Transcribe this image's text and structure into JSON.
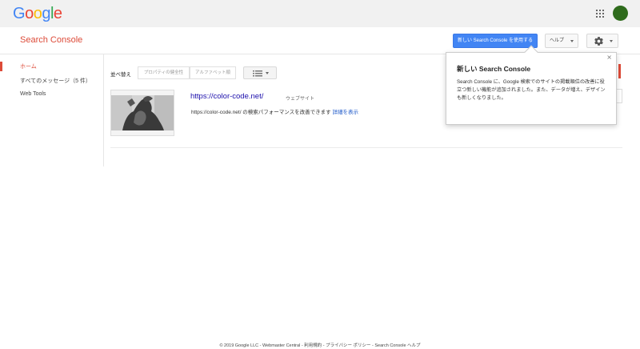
{
  "header": {
    "logo_letters": [
      {
        "char": "G",
        "color": "#4285f4"
      },
      {
        "char": "o",
        "color": "#ea4335"
      },
      {
        "char": "o",
        "color": "#fbbc05"
      },
      {
        "char": "g",
        "color": "#4285f4"
      },
      {
        "char": "l",
        "color": "#34a853"
      },
      {
        "char": "e",
        "color": "#ea4335"
      }
    ],
    "apps_icon": "apps-grid-icon",
    "avatar_color": "#2e6b1c"
  },
  "subheader": {
    "product_title": "Search Console",
    "new_search_console_button": "新しい Search Console を使用する",
    "help_button": "ヘルプ",
    "settings_icon": "gear-icon"
  },
  "sidebar": {
    "items": [
      {
        "label": "ホーム",
        "active": true
      },
      {
        "label": "すべてのメッセージ（5 件）",
        "active": false
      },
      {
        "label": "Web Tools",
        "active": false
      }
    ]
  },
  "toolbar": {
    "sort_label": "並べ替え",
    "sort_options": [
      "プロパティの健全性",
      "アルファベット順"
    ],
    "view_icon": "list-view-icon"
  },
  "sites": [
    {
      "url": "https://color-code.net/",
      "type": "ウェブサイト",
      "description": "https://color-code.net/ の検索パフォーマンスを改善できます",
      "details_link": "詳細を表示"
    }
  ],
  "popover": {
    "title": "新しい Search Console",
    "body": "Search Console に、Google 検索でのサイトの掲載順位の改善に役立つ新しい機能が追加されました。また、データが増え、デザインも新しくなりました。",
    "close_label": "×"
  },
  "footer": {
    "text": "© 2019 Google LLC - Webmaster Central - 利用規約 - プライバシー ポリシー - Search Console ヘルプ"
  },
  "colors": {
    "brand_red": "#dd4b39",
    "primary_blue": "#4285f4",
    "link_blue": "#1a0dab"
  }
}
